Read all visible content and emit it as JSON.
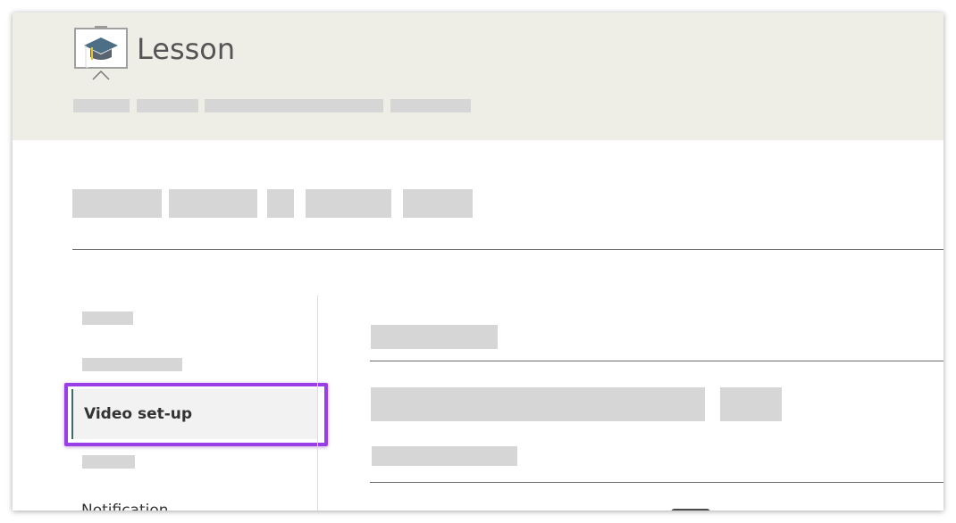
{
  "header": {
    "title": "Lesson",
    "logo_icon": "lesson-presentation-icon",
    "breadcrumbs_redacted": 4
  },
  "tabs_redacted": 5,
  "sidebar": {
    "active_item": {
      "label": "Video set-up"
    },
    "partial_item": {
      "label": "Notification"
    },
    "highlight_color": "#9a3ee8"
  },
  "colors": {
    "header_bg": "#efeee6",
    "placeholder": "#d6d6d6",
    "active_bar": "#3c6e67"
  }
}
